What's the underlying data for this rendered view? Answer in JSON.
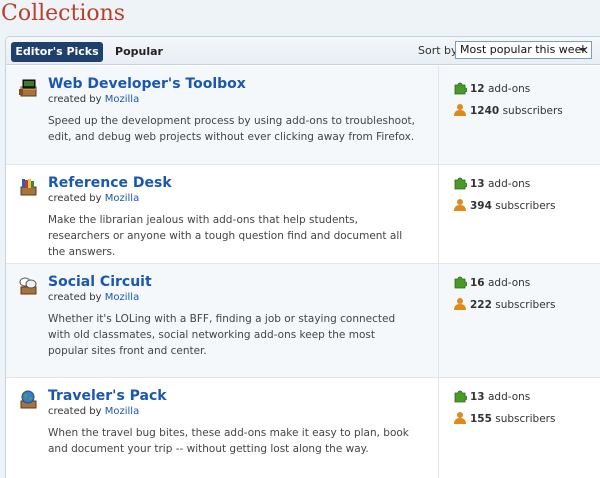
{
  "page": {
    "title": "Collections"
  },
  "tabs": {
    "active": "Editor's Picks",
    "inactive": "Popular"
  },
  "sort": {
    "label": "Sort by",
    "selected": "Most popular this week"
  },
  "collections": [
    {
      "title": "Web Developer's Toolbox",
      "created_by_prefix": "created by",
      "author": "Mozilla",
      "description": "Speed up the development process by using add-ons to troubleshoot, edit, and debug web projects without ever clicking away from Firefox.",
      "addons_count": "12",
      "addons_label": "add-ons",
      "subscribers_count": "1240",
      "subscribers_label": "subscribers",
      "icon": "toolbox-icon"
    },
    {
      "title": "Reference Desk",
      "created_by_prefix": "created by",
      "author": "Mozilla",
      "description": "Make the librarian jealous with add-ons that help students, researchers or anyone with a tough question find and document all the answers.",
      "addons_count": "13",
      "addons_label": "add-ons",
      "subscribers_count": "394",
      "subscribers_label": "subscribers",
      "icon": "books-icon"
    },
    {
      "title": "Social Circuit",
      "created_by_prefix": "created by",
      "author": "Mozilla",
      "description": "Whether it's LOLing with a BFF, finding a job or staying connected with old classmates, social networking add-ons keep the most popular sites front and center.",
      "addons_count": "16",
      "addons_label": "add-ons",
      "subscribers_count": "222",
      "subscribers_label": "subscribers",
      "icon": "speech-bubbles-icon"
    },
    {
      "title": "Traveler's Pack",
      "created_by_prefix": "created by",
      "author": "Mozilla",
      "description": "When the travel bug bites, these add-ons make it easy to plan, book and document your trip -- without getting lost along the way.",
      "addons_count": "13",
      "addons_label": "add-ons",
      "subscribers_count": "155",
      "subscribers_label": "subscribers",
      "icon": "globe-icon"
    }
  ],
  "colors": {
    "title_red": "#b8402a",
    "link_blue": "#1a58b0",
    "tab_active": "#1f3f6c",
    "puzzle_green": "#4a9a2a",
    "person_orange": "#e08a1e"
  }
}
